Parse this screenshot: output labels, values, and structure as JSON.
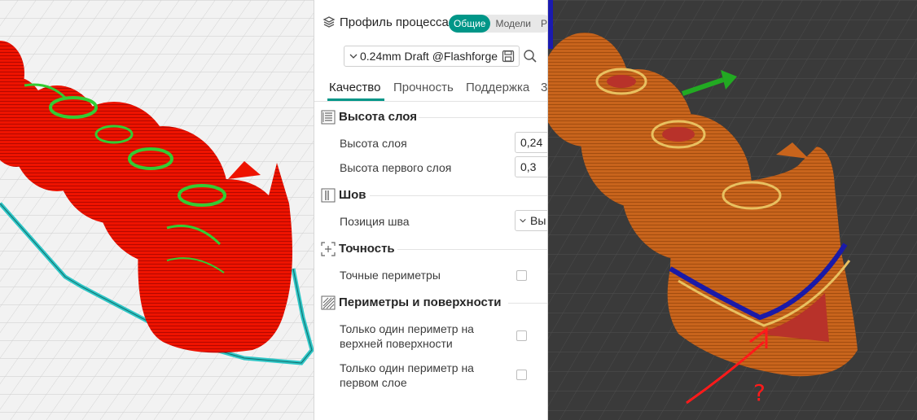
{
  "panel": {
    "title": "Профиль процесса",
    "mode_tabs": [
      "Общие",
      "Модели",
      "P"
    ],
    "preset": "0.24mm Draft @Flashforge",
    "icons": {
      "header": "layers-icon",
      "save": "save-icon",
      "search": "search-icon",
      "dropdown": "chevron-down-icon"
    },
    "accent": "#009688",
    "tabs": [
      "Качество",
      "Прочность",
      "Поддержка",
      "3"
    ],
    "sections": {
      "layer_height": {
        "title": "Высота слоя",
        "rows": [
          {
            "label": "Высота слоя",
            "value": "0,24"
          },
          {
            "label": "Высота первого слоя",
            "value": "0,3"
          }
        ]
      },
      "seam": {
        "title": "Шов",
        "rows": [
          {
            "label": "Позиция шва",
            "value": "Вы"
          }
        ]
      },
      "precision": {
        "title": "Точность",
        "rows": [
          {
            "label": "Точные периметры",
            "checked": false
          }
        ]
      },
      "walls": {
        "title": "Периметры и поверхности",
        "rows": [
          {
            "label1": "Только один периметр на",
            "label2": "верхней поверхности",
            "checked": false
          },
          {
            "label1": "Только один периметр на",
            "label2": "первом слое",
            "checked": false
          }
        ]
      }
    }
  },
  "viewport_left": {
    "model_color": "#ff1a00",
    "top_surface_color": "#33cc33",
    "skirt_color": "#2fc6c6"
  },
  "viewport_right": {
    "model_color": "#c8641c",
    "annotation_color": "#ff1a1a",
    "annotation_text": "?"
  }
}
